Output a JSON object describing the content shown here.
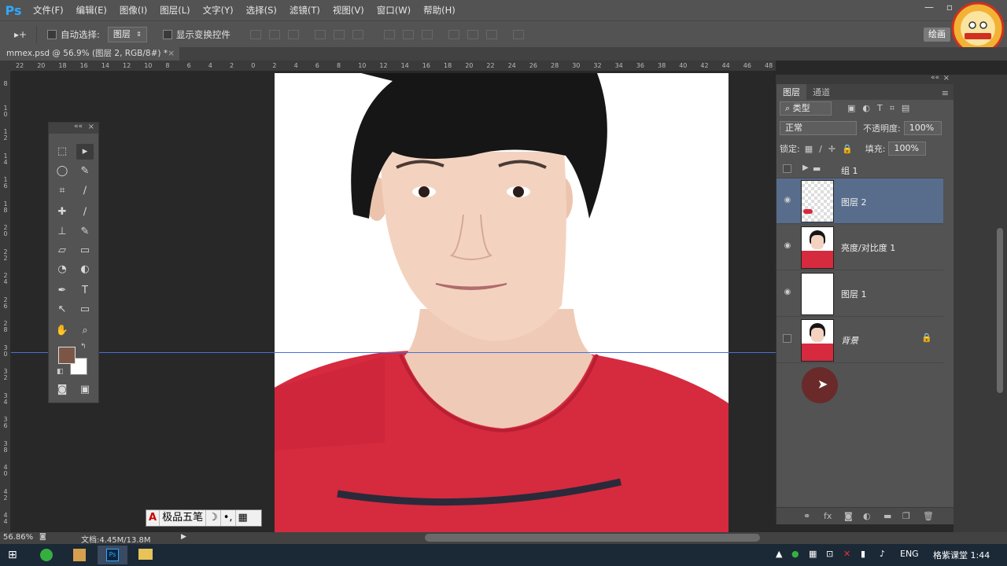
{
  "app": {
    "logo": "Ps"
  },
  "menu": [
    "文件(F)",
    "编辑(E)",
    "图像(I)",
    "图层(L)",
    "文字(Y)",
    "选择(S)",
    "滤镜(T)",
    "视图(V)",
    "窗口(W)",
    "帮助(H)"
  ],
  "options": {
    "move_tool": "▸+",
    "auto_select_label": "自动选择:",
    "auto_select_value": "图层",
    "show_transform_label": "显示变换控件",
    "workspace": "绘画"
  },
  "document": {
    "tab_title": "mmex.psd @ 56.9% (图层 2, RGB/8#) *",
    "close": "×"
  },
  "rulers": {
    "top": [
      "22",
      "20",
      "18",
      "16",
      "14",
      "12",
      "10",
      "8",
      "6",
      "4",
      "2",
      "0",
      "2",
      "4",
      "6",
      "8",
      "10",
      "12",
      "14",
      "16",
      "18",
      "20",
      "22",
      "24",
      "26",
      "28",
      "30",
      "32",
      "34",
      "36",
      "38",
      "40",
      "42",
      "44",
      "46",
      "48"
    ],
    "left": [
      "8",
      "1 0",
      "1 2",
      "1 4",
      "1 6",
      "1 8",
      "2 0",
      "2 2",
      "2 4",
      "2 6",
      "2 8",
      "3 0",
      "3 2",
      "3 4",
      "3 6",
      "3 8",
      "4 0",
      "4 2",
      "4 4"
    ]
  },
  "layers_panel": {
    "tabs": [
      "图层",
      "通道"
    ],
    "filter_label": "类型",
    "blend_mode": "正常",
    "opacity_label": "不透明度:",
    "opacity_value": "100%",
    "lock_label": "锁定:",
    "fill_label": "填充:",
    "fill_value": "100%",
    "group": {
      "name": "组 1"
    },
    "layers": [
      {
        "name": "图层 2",
        "selected": true
      },
      {
        "name": "亮度/对比度 1",
        "selected": false
      },
      {
        "name": "图层 1",
        "selected": false
      },
      {
        "name": "背景",
        "selected": false
      }
    ]
  },
  "status": {
    "zoom": "56.86%",
    "doc_info": "文档:4.45M/13.8M"
  },
  "ime": {
    "label": "极品五笔"
  },
  "taskbar": {
    "lang": "ENG",
    "clock": "格紫课堂 1:44"
  },
  "colors": {
    "foreground": "#7b5646",
    "background": "#ffffff",
    "guide": "#4a6fd6",
    "shirt": "#d62a3f"
  }
}
